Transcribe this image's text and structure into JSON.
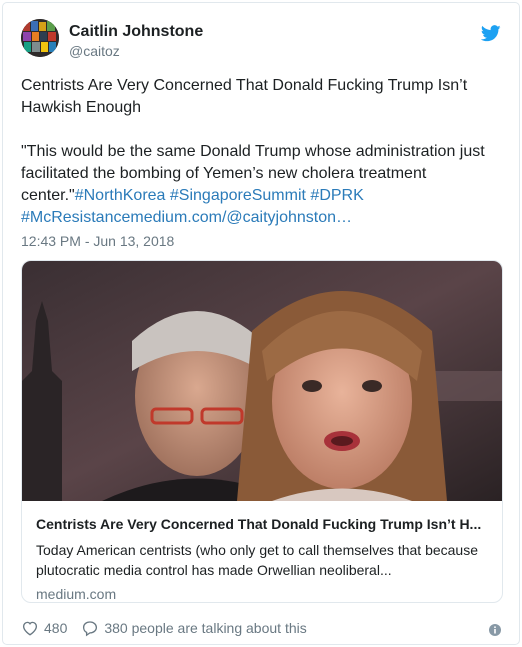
{
  "author": {
    "display_name": "Caitlin Johnstone",
    "handle": "@caitoz",
    "avatar_icon": "avatar-image"
  },
  "tweet": {
    "line1": "Centrists Are Very Concerned That Donald Fucking Trump Isn’t",
    "line2": "Hawkish Enough",
    "quote_line1": "\"This would be the same Donald Trump whose administration just",
    "quote_line2": "facilitated the bombing of Yemen’s new cholera treatment",
    "quote_line3_text": "center.\"",
    "hashtag_1": "#NorthKorea",
    "hashtag_2": "#SingaporeSummit",
    "hashtag_3": "#DPRK",
    "hashtag_4": "#McResistance",
    "link_text": "medium.com/@caityjohnston…",
    "timestamp": "12:43 PM - Jun 13, 2018"
  },
  "card": {
    "title": "Centrists Are Very Concerned That Donald Fucking Trump Isn’t H...",
    "desc_line1": "Today American centrists (who only get to call themselves that because",
    "desc_line2": "plutocratic media control has made Orwellian neoliberal...",
    "domain": "medium.com"
  },
  "actions": {
    "likes": "480",
    "replies_text": "380 people are talking about this"
  },
  "colors": {
    "link": "#2b7bb9",
    "twitter_blue": "#1da1f2",
    "secondary_text": "#697882",
    "border": "#e1e8ed"
  }
}
